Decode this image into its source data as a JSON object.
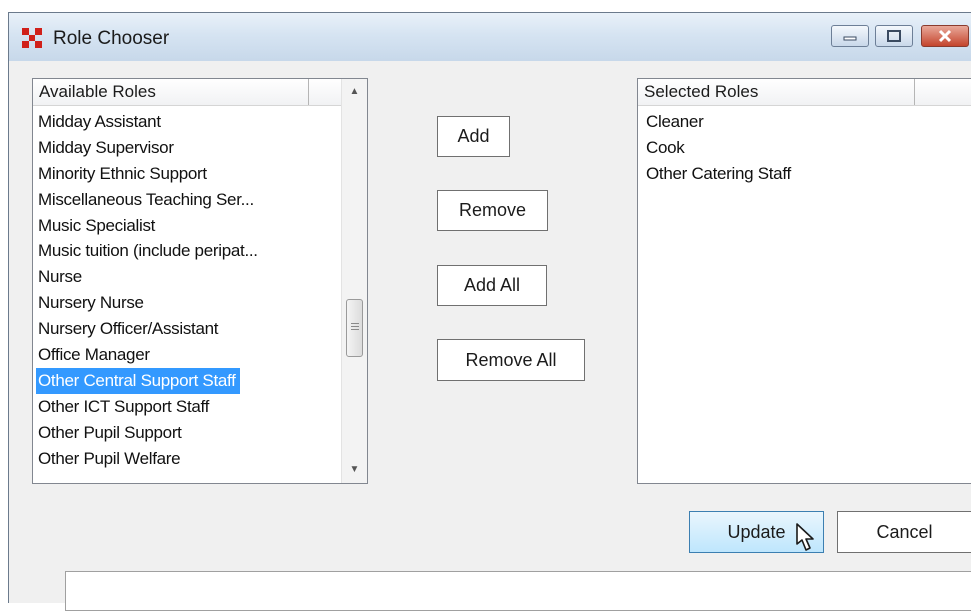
{
  "window": {
    "title": "Role Chooser",
    "controls": [
      "minimize-icon",
      "maximize-icon",
      "close-icon"
    ]
  },
  "available_roles": {
    "header": "Available Roles",
    "items": [
      "Midday Assistant",
      "Midday Supervisor",
      "Minority Ethnic Support",
      "Miscellaneous Teaching Ser...",
      "Music Specialist",
      "Music tuition (include peripat...",
      "Nurse",
      "Nursery Nurse",
      "Nursery Officer/Assistant",
      "Office Manager",
      "Other Central Support Staff",
      "Other ICT Support Staff",
      "Other Pupil Support",
      "Other Pupil Welfare"
    ],
    "selected": "Other Central Support Staff"
  },
  "selected_roles": {
    "header": "Selected Roles",
    "items": [
      "Cleaner",
      "Cook",
      "Other Catering Staff"
    ]
  },
  "buttons": {
    "add": "Add",
    "remove": "Remove",
    "add_all": "Add All",
    "remove_all": "Remove All",
    "update": "Update",
    "cancel": "Cancel"
  },
  "colors": {
    "selection": "#3399ff",
    "title_bar": "#d6e4f2",
    "close_button": "#c4452d"
  }
}
